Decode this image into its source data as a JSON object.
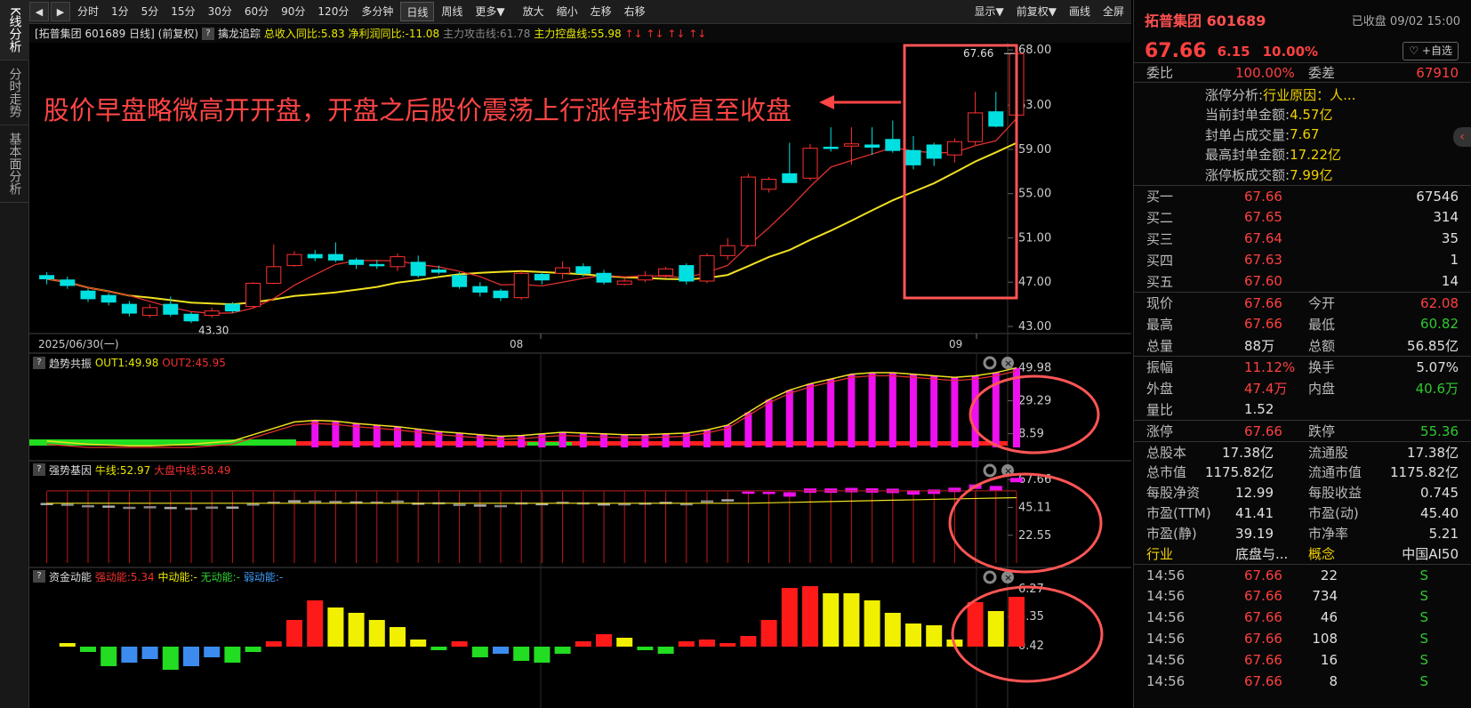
{
  "left_tabs": [
    "K线分析",
    "分时走势",
    "基本面分析"
  ],
  "toolbar": {
    "periods": [
      "分时",
      "1分",
      "5分",
      "15分",
      "30分",
      "60分",
      "90分",
      "120分",
      "多分钟",
      "日线",
      "周线",
      "更多▼"
    ],
    "active_period": "日线",
    "actions": [
      "放大",
      "缩小",
      "左移",
      "右移"
    ],
    "right": [
      "显示▼",
      "前复权▼",
      "画线",
      "全屏"
    ]
  },
  "infobar": {
    "name": "[拓普集团 601689 日线]",
    "adj": "(前复权)",
    "indicator": "擒龙追踪",
    "revenue": "总收入同比:5.83",
    "profit": "净利润同比:-11.08",
    "attack": "主力攻击线:61.78",
    "control": "主力控盘线:55.98",
    "arrows": "↑↓ ↑↓ ↑↓ ↑↓"
  },
  "annotation": "股价早盘略微高开开盘，开盘之后股价震荡上行涨停封板直至收盘",
  "main_chart": {
    "y_ticks": [
      "68.00",
      "63.00",
      "59.00",
      "55.00",
      "51.00",
      "47.00",
      "43.00"
    ],
    "x_labels": [
      "2025/06/30(一)",
      "08",
      "09"
    ],
    "high_label": "67.66",
    "low_label": "43.30"
  },
  "panel2": {
    "title": "趋势共振",
    "l1": "OUT1:49.98",
    "l2": "OUT2:45.95",
    "ticks": [
      "49.98",
      "29.29",
      "8.59"
    ]
  },
  "panel3": {
    "title": "强势基因",
    "l1": "牛线:52.97",
    "l2": "大盘中线:58.49",
    "ticks": [
      "67.66",
      "45.11",
      "22.55"
    ]
  },
  "panel4": {
    "title": "资金动能",
    "l1": "强动能:5.34",
    "l2": "中动能:-",
    "l3": "无动能:-",
    "l4": "弱动能:-",
    "ticks": [
      "6.27",
      "3.35",
      "0.42"
    ]
  },
  "quote": {
    "name": "拓普集团 601689",
    "status": "已收盘 09/02 15:00",
    "price": "67.66",
    "change": "6.15",
    "pct": "10.00%",
    "fav": "♡ +自选",
    "weibi_label": "委比",
    "weibi": "100.00%",
    "weicha_label": "委差",
    "weicha": "67910",
    "limit_info": [
      {
        "k": "涨停分析:",
        "v": "行业原因：人..."
      },
      {
        "k": "当前封单金额:",
        "v": "4.57亿"
      },
      {
        "k": "封单占成交量:",
        "v": "7.67"
      },
      {
        "k": "最高封单金额:",
        "v": "17.22亿"
      },
      {
        "k": "涨停板成交额:",
        "v": "7.99亿"
      }
    ],
    "bids": [
      {
        "k": "买一",
        "p": "67.66",
        "v": "67546"
      },
      {
        "k": "买二",
        "p": "67.65",
        "v": "314"
      },
      {
        "k": "买三",
        "p": "67.64",
        "v": "35"
      },
      {
        "k": "买四",
        "p": "67.63",
        "v": "1"
      },
      {
        "k": "买五",
        "p": "67.60",
        "v": "14"
      }
    ],
    "stats1": [
      {
        "k1": "现价",
        "v1": "67.66",
        "c1": "red",
        "k2": "今开",
        "v2": "62.08",
        "c2": "red"
      },
      {
        "k1": "最高",
        "v1": "67.66",
        "c1": "red",
        "k2": "最低",
        "v2": "60.82",
        "c2": "grn"
      },
      {
        "k1": "总量",
        "v1": "88万",
        "c1": "wht",
        "k2": "总额",
        "v2": "56.85亿",
        "c2": "wht"
      }
    ],
    "stats2": [
      {
        "k1": "振幅",
        "v1": "11.12%",
        "c1": "red",
        "k2": "换手",
        "v2": "5.07%",
        "c2": "wht"
      },
      {
        "k1": "外盘",
        "v1": "47.4万",
        "c1": "red",
        "k2": "内盘",
        "v2": "40.6万",
        "c2": "grn"
      },
      {
        "k1": "量比",
        "v1": "1.52",
        "c1": "wht",
        "k2": "",
        "v2": "",
        "c2": "wht"
      }
    ],
    "limit_row": {
      "k1": "涨停",
      "v1": "67.66",
      "k2": "跌停",
      "v2": "55.36"
    },
    "stats3": [
      {
        "k1": "总股本",
        "v1": "17.38亿",
        "k2": "流通股",
        "v2": "17.38亿"
      },
      {
        "k1": "总市值",
        "v1": "1175.82亿",
        "k2": "流通市值",
        "v2": "1175.82亿"
      },
      {
        "k1": "每股净资",
        "v1": "12.99",
        "k2": "每股收益",
        "v2": "0.745"
      },
      {
        "k1": "市盈(TTM)",
        "v1": "41.41",
        "k2": "市盈(动)",
        "v2": "45.40"
      },
      {
        "k1": "市盈(静)",
        "v1": "39.19",
        "k2": "市净率",
        "v2": "5.21"
      }
    ],
    "industry": {
      "k1": "行业",
      "v1": "底盘与...",
      "k2": "概念",
      "v2": "中国AI50"
    },
    "ticks": [
      {
        "t": "14:56",
        "p": "67.66",
        "v": "22",
        "s": "S"
      },
      {
        "t": "14:56",
        "p": "67.66",
        "v": "734",
        "s": "S"
      },
      {
        "t": "14:56",
        "p": "67.66",
        "v": "46",
        "s": "S"
      },
      {
        "t": "14:56",
        "p": "67.66",
        "v": "108",
        "s": "S"
      },
      {
        "t": "14:56",
        "p": "67.66",
        "v": "16",
        "s": "S"
      },
      {
        "t": "14:56",
        "p": "67.66",
        "v": "8",
        "s": "S"
      }
    ]
  },
  "chart_data": {
    "type": "candlestick",
    "candles_ohlc": [
      [
        47.6,
        47.3,
        47.9,
        46.8
      ],
      [
        47.2,
        46.7,
        47.5,
        46.4
      ],
      [
        46.2,
        45.5,
        46.4,
        45.2
      ],
      [
        45.8,
        45.2,
        46.0,
        44.9
      ],
      [
        45.0,
        44.2,
        45.3,
        43.9
      ],
      [
        44.0,
        44.7,
        45.0,
        43.8
      ],
      [
        45.0,
        44.1,
        45.7,
        43.9
      ],
      [
        44.1,
        43.5,
        44.3,
        43.3
      ],
      [
        44.0,
        44.4,
        44.7,
        43.8
      ],
      [
        45.0,
        44.4,
        45.2,
        44.2
      ],
      [
        44.8,
        46.9,
        47.0,
        44.7
      ],
      [
        46.9,
        48.4,
        50.4,
        46.8
      ],
      [
        48.5,
        49.5,
        49.8,
        48.4
      ],
      [
        49.5,
        49.2,
        49.9,
        48.9
      ],
      [
        49.5,
        49.0,
        50.6,
        48.8
      ],
      [
        49.0,
        48.6,
        49.2,
        48.2
      ],
      [
        48.6,
        48.5,
        49.0,
        48.2
      ],
      [
        48.4,
        49.3,
        49.6,
        48.0
      ],
      [
        48.8,
        47.6,
        49.4,
        47.4
      ],
      [
        48.1,
        47.9,
        48.5,
        47.7
      ],
      [
        47.6,
        46.6,
        47.9,
        46.4
      ],
      [
        46.6,
        46.1,
        47.0,
        45.7
      ],
      [
        46.2,
        45.6,
        46.4,
        45.3
      ],
      [
        45.6,
        47.8,
        48.0,
        45.4
      ],
      [
        47.7,
        47.2,
        47.9,
        46.8
      ],
      [
        47.8,
        48.3,
        48.9,
        47.3
      ],
      [
        48.4,
        47.8,
        48.7,
        47.5
      ],
      [
        47.8,
        47.0,
        48.1,
        46.8
      ],
      [
        46.8,
        47.1,
        47.4,
        46.7
      ],
      [
        47.2,
        47.6,
        48.0,
        47.0
      ],
      [
        47.6,
        48.2,
        48.4,
        47.4
      ],
      [
        48.5,
        47.1,
        48.7,
        46.8
      ],
      [
        47.1,
        49.4,
        49.6,
        46.9
      ],
      [
        49.4,
        50.3,
        51.0,
        49.0
      ],
      [
        50.3,
        56.5,
        56.8,
        50.2
      ],
      [
        55.4,
        56.3,
        56.5,
        55.1
      ],
      [
        56.8,
        56.0,
        59.6,
        56.0
      ],
      [
        56.4,
        59.1,
        59.5,
        56.2
      ],
      [
        59.2,
        59.1,
        61.0,
        58.8
      ],
      [
        59.3,
        59.5,
        61.0,
        57.6
      ],
      [
        59.4,
        59.2,
        61.0,
        58.5
      ],
      [
        59.9,
        58.9,
        61.6,
        58.7
      ],
      [
        58.9,
        57.6,
        60.2,
        57.2
      ],
      [
        59.4,
        58.2,
        59.6,
        57.5
      ],
      [
        58.5,
        59.7,
        60.0,
        57.8
      ],
      [
        59.7,
        62.3,
        64.2,
        59.4
      ],
      [
        62.4,
        61.1,
        64.2,
        61.0
      ],
      [
        62.1,
        67.66,
        67.66,
        60.82
      ]
    ],
    "ma_red_start": 47.5,
    "ma_yellow_end": 56.0,
    "y_range": [
      43.0,
      68.0
    ],
    "x_axis_labels": [
      "2025/06/30(一)",
      "08",
      "09"
    ]
  }
}
